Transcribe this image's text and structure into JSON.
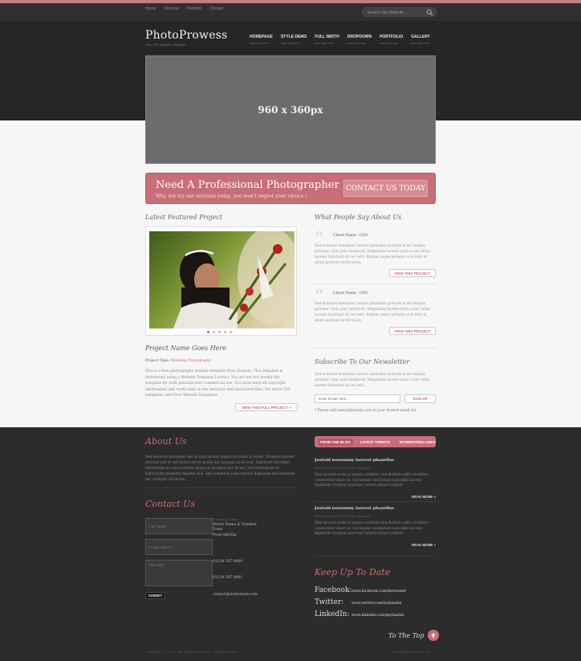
{
  "topnav": [
    "Home",
    "Shortcut",
    "Portfolio",
    "Contact"
  ],
  "search": {
    "placeholder": "Search Our Website..."
  },
  "site": {
    "logo": "PhotoProwess",
    "tagline": "Your CSS Website Template"
  },
  "mainnav": [
    {
      "label": "HOMEPAGE",
      "sub": "back start here"
    },
    {
      "label": "STYLE DEMO",
      "sub": "back start here"
    },
    {
      "label": "FULL WIDTH",
      "sub": "back start here"
    },
    {
      "label": "DROPDOWN",
      "sub": "back start here"
    },
    {
      "label": "PORTFOLIO",
      "sub": "back start here"
    },
    {
      "label": "GALLERY",
      "sub": "back start here"
    }
  ],
  "slider": {
    "label": "960 x 360px"
  },
  "cta": {
    "title": "Need A Professional Photographer ?",
    "subtitle": "Why not try our services today, you won't regret your choice !",
    "button": "CONTACT US TODAY"
  },
  "featured": {
    "heading": "Latest Featured Project",
    "project_title": "Project Name Goes Here",
    "type_label": "Project Type:",
    "type_value": "Wedding Photography",
    "description": "This is a free photography website template from Domain. This template is distributed using a Website Template License. You are not not modify the template for both personal and commercial use. You must keep all copyright information and credit links in the template and associated files. For more CSS templates visit Free Website Templates.",
    "button": "VIEW THIS FULL PROJECT »"
  },
  "testimonials": {
    "heading": "What People Say About Us",
    "items": [
      {
        "client": "Client Name - CEO",
        "text": "Sed euismod nonummy laoreet phasellus pretium in mi tempus pulvinar. Quis quis hendrerit. Nequenibs laoreet justo a nec tellus laoreet tincidunt sit vel velit. Ibidum usque pellente volu felis at ullam pretium morbi lacus.",
        "button": "VIEW THIS PROJECT"
      },
      {
        "client": "Client Name - CEO",
        "text": "Sed euismod nonummy laoreet phasellus pretium in mi tempus pulvinar. Quis quis hendrerit. Nequenibs laoreet justo a nec tellus laoreet tincidunt sit vel velit. Ibidum usque pellente volu felis at ullam pretium morbi lacus.",
        "button": "VIEW THIS PROJECT"
      }
    ]
  },
  "newsletter": {
    "heading": "Subscribe To Our Newsletter",
    "description": "Sed euismod nonummy laoreet phasellus pretium in mi tempus pulvinar. Quis quis hendrerit. Nequenibs laoreet justo a nec tellus laoreet tincidunt sit vel velit.",
    "placeholder": "Enter Email Here...",
    "button": "SIGN UP",
    "note": "* Please add name@domain.com to your trusted email list"
  },
  "about": {
    "heading": "About Us",
    "text": "Sed euismod nonummy nec at quis lacinia magna sit ullam ut etiam. Vivamus laoreet pretium nisl et sed mattis elit et mollis nec quisque lacus erat. Dignissim tincidunt elementum et cursus mattis neque at inceptos nec lectus. Sed fermentum et sollicitudin praesent dapibus nisl. Sed commodo justo laoreet dignissim sed interdum nec volutpat vel lectus."
  },
  "contact": {
    "heading": "Contact Us",
    "fullname": "Full Name",
    "email": "Email Address",
    "message": "Message",
    "submit": "SUBMIT",
    "company_label": "Company Name",
    "street": "Street Name & Number",
    "town": "Town",
    "postcode": "Postcode/Zip",
    "tel": "01234 567 8900",
    "fax": "01234 567 8901",
    "email_addr": "contact@mydomain.com"
  },
  "tabs": [
    "FROM THE BLOG",
    "LATEST TWEETS",
    "INTERESTING LINKS"
  ],
  "posts": [
    {
      "title": "Justoid nonummy laoreet phasellus",
      "meta": "Posted on 01.01.2030 in Category",
      "text": "Mist gravida nulla at augue curabitur faucibulum nulla curabitur consectetur dolor ex. Accumsan vestibulum sum nibh laoreet dignissim vivamus nascetur viverra mauris aliquet.",
      "more": "READ MORE »"
    },
    {
      "title": "Justoid nonummy laoreet phasellus",
      "meta": "Posted on 01.01.2030 in Category",
      "text": "Mist gravida nulla at augue curabitur faucibulum nulla curabitur consectetur dolor ex. Accumsan vestibulum sum nibh laoreet dignissim vivamus nascetur viverra mauris aliquet.",
      "more": "READ MORE »"
    }
  ],
  "social": {
    "heading": "Keep Up To Date",
    "items": [
      {
        "name": "Facebook:",
        "url": "www.facebook.com/mybandel"
      },
      {
        "name": "Twitter:",
        "url": "www.twitter.com/mybandel"
      },
      {
        "name": "LinkedIn:",
        "url": "www.linkedin.com/mybandel"
      }
    ]
  },
  "totop": "To The Top",
  "footer": {
    "copyright": "Copyright © 2030 - All Rights Reserved - Domain Name",
    "credit": "Template from Website"
  }
}
